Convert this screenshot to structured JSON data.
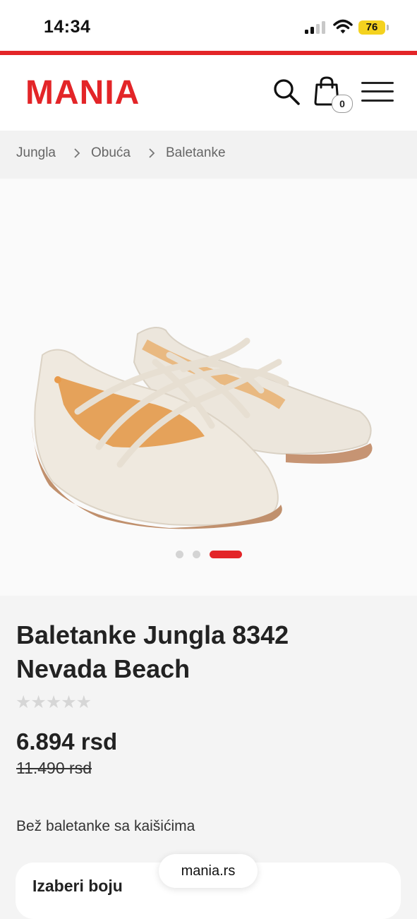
{
  "status_bar": {
    "time": "14:34",
    "battery": "76"
  },
  "header": {
    "logo": "MANIA",
    "cart_count": "0",
    "icons": {
      "search": "search-icon",
      "cart": "shopping-bag-icon",
      "menu": "hamburger-menu-icon"
    }
  },
  "breadcrumb": [
    "Jungla",
    "Obuća",
    "Baletanke"
  ],
  "gallery": {
    "image": "beige-ballet-flats-with-straps",
    "slide_count": 3,
    "active_slide": 3
  },
  "product": {
    "title": "Baletanke Jungla 8342 Nevada Beach",
    "rating_stars": "★★★★★",
    "rating_value": 0,
    "price": "6.894 rsd",
    "old_price": "11.490 rsd",
    "description": "Bež baletanke sa kaišićima",
    "color_section_label": "Izaberi boju"
  },
  "browser": {
    "url": "mania.rs"
  },
  "colors": {
    "brand_red": "#e32528",
    "text_dark": "#222222",
    "battery_yellow": "#f4d21f"
  }
}
